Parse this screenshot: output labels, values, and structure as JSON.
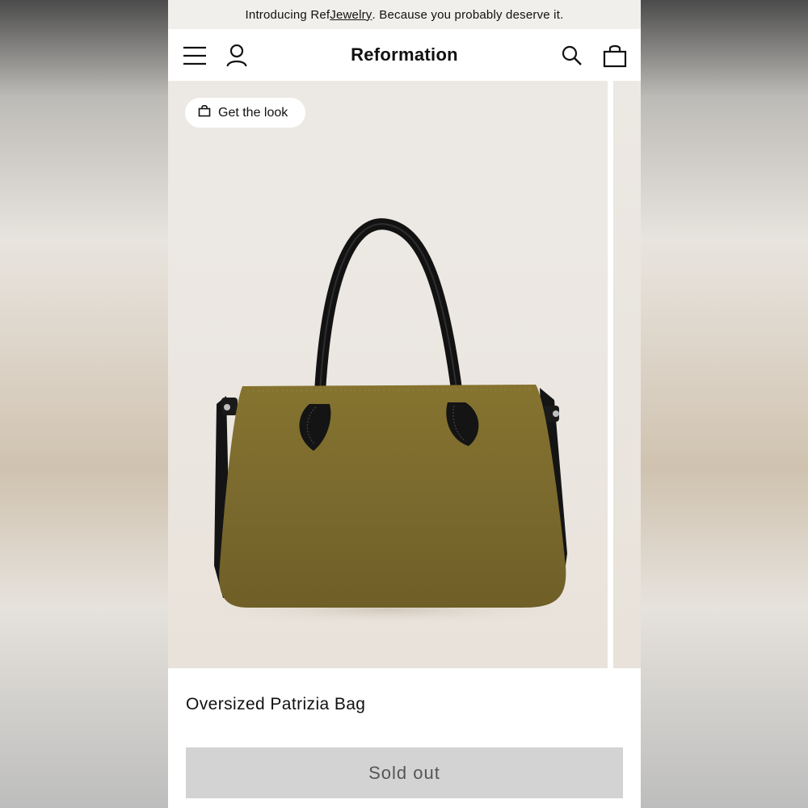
{
  "promo_bar": {
    "prefix": "Introducing Ref ",
    "link": "Jewelry",
    "suffix": ". Because you probably deserve it."
  },
  "header": {
    "brand": "Reformation",
    "icons": [
      "menu-icon",
      "account-icon",
      "search-icon",
      "shopping-bag-icon"
    ]
  },
  "gallery": {
    "get_look_label": "Get the look",
    "get_look_icon": "shopping-bag-icon"
  },
  "product": {
    "title": "Oversized Patrizia Bag",
    "button_label": "Sold out"
  },
  "colors": {
    "suede": "#7b6a2e",
    "leather": "#151515",
    "button_disabled": "#d3d3d3"
  }
}
